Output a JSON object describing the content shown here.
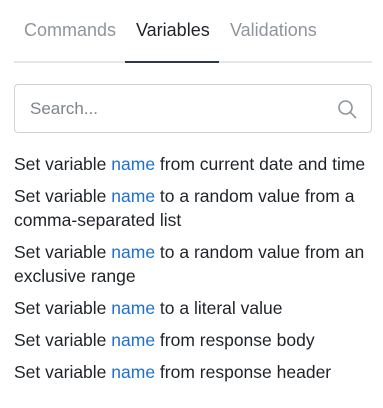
{
  "tabs": [
    {
      "label": "Commands",
      "active": false
    },
    {
      "label": "Variables",
      "active": true
    },
    {
      "label": "Validations",
      "active": false
    }
  ],
  "search": {
    "placeholder": "Search...",
    "value": "",
    "icon": "search-icon"
  },
  "items": [
    {
      "prefix": "Set variable ",
      "variable": "name",
      "suffix": " from current date and time"
    },
    {
      "prefix": "Set variable ",
      "variable": "name",
      "suffix": " to a random value from a comma-separated list"
    },
    {
      "prefix": "Set variable ",
      "variable": "name",
      "suffix": " to a random value from an exclusive range"
    },
    {
      "prefix": "Set variable ",
      "variable": "name",
      "suffix": " to a literal value"
    },
    {
      "prefix": "Set variable ",
      "variable": "name",
      "suffix": " from response body"
    },
    {
      "prefix": "Set variable ",
      "variable": "name",
      "suffix": " from response header"
    }
  ],
  "colors": {
    "variable": "#1f6fd1",
    "text": "#1f2328",
    "tab_inactive": "#8f959b"
  }
}
